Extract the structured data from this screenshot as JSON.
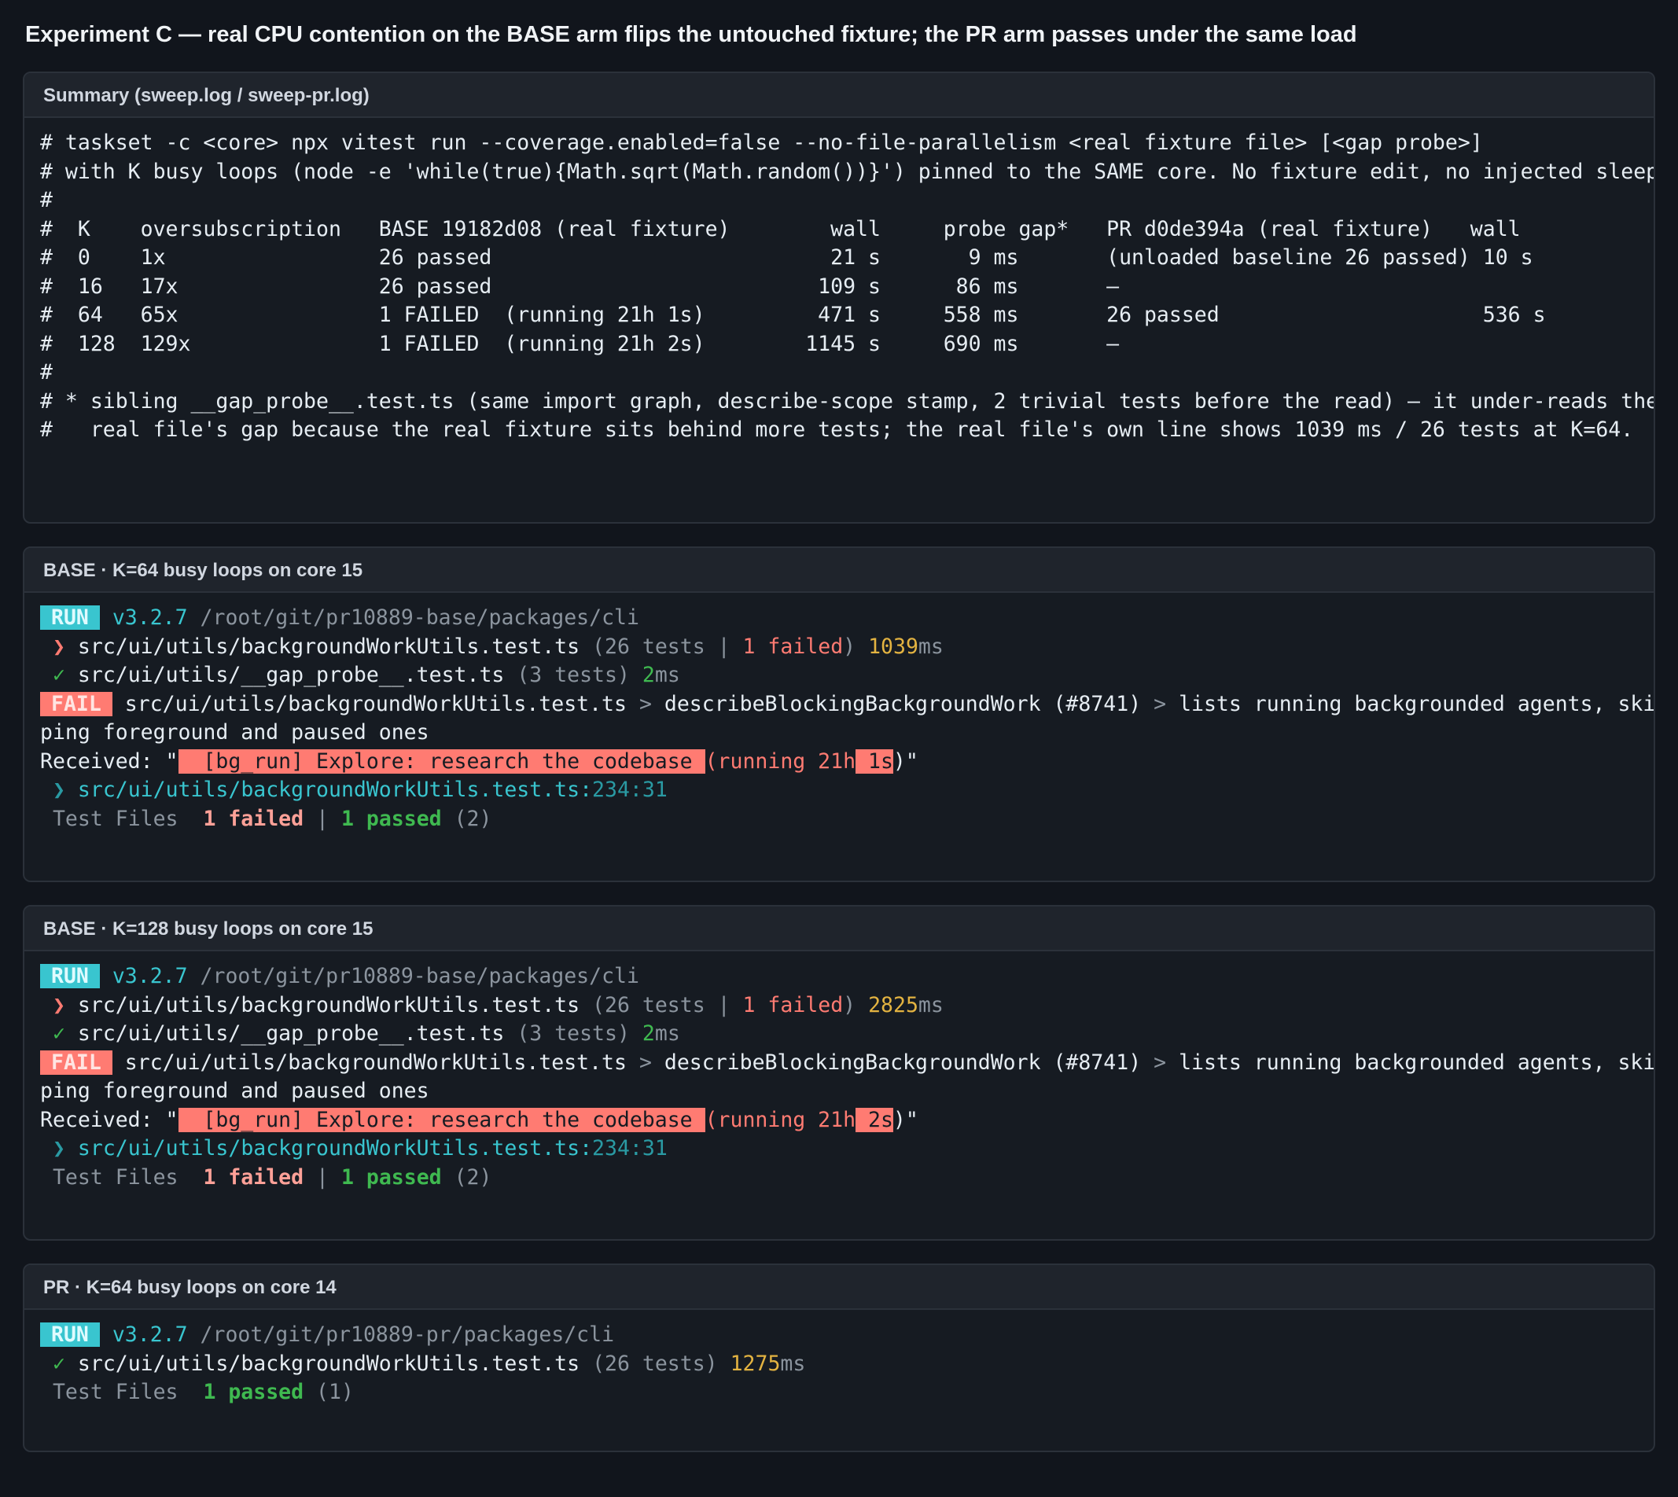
{
  "page": {
    "title": "Experiment C — real CPU contention on the BASE arm flips the untouched fixture; the PR arm passes under the same load"
  },
  "summary": {
    "header": "Summary (sweep.log / sweep-pr.log)",
    "lines": [
      "# taskset -c <core> npx vitest run --coverage.enabled=false --no-file-parallelism <real fixture file> [<gap probe>]",
      "# with K busy loops (node -e 'while(true){Math.sqrt(Math.random())}') pinned to the SAME core. No fixture edit, no injected sleep.",
      "#",
      "#  K    oversubscription   BASE 19182d08 (real fixture)        wall     probe gap*   PR d0de394a (real fixture)   wall",
      "#  0    1x                 26 passed                           21 s       9 ms       (unloaded baseline 26 passed) 10 s",
      "#  16   17x                26 passed                          109 s      86 ms       —",
      "#  64   65x                1 FAILED  (running 21h 1s)         471 s     558 ms       26 passed                     536 s",
      "#  128  129x               1 FAILED  (running 21h 2s)        1145 s     690 ms       —",
      "#",
      "# * sibling __gap_probe__.test.ts (same import graph, describe-scope stamp, 2 trivial tests before the read) — it under-reads the",
      "#   real file's gap because the real fixture sits behind more tests; the real file's own line shows 1039 ms / 26 tests at K=64."
    ]
  },
  "base64": {
    "header": "BASE · K=64 busy loops on core 15",
    "run_badge": "RUN",
    "version": "v3.2.7",
    "path": "/root/git/pr10889-base/packages/cli",
    "file1_marker": "❯",
    "file1": "src/ui/utils/backgroundWorkUtils.test.ts",
    "file1_open": "(26 tests | ",
    "file1_failed": "1 failed",
    "file1_close": ")",
    "file1_time": "1039",
    "file1_unit": "ms",
    "file2_marker": "✓",
    "file2": "src/ui/utils/__gap_probe__.test.ts",
    "file2_count": "(3 tests)",
    "file2_time": "2",
    "file2_unit": "ms",
    "fail_badge": "FAIL",
    "fail_file": "src/ui/utils/backgroundWorkUtils.test.ts",
    "sep": ">",
    "fail_describe": "describeBlockingBackgroundWork (#8741)",
    "fail_test_a": "lists running backgrounded agents, skip",
    "fail_test_b": "ping foreground and paused ones",
    "received_label": "Received: \"",
    "received_hl1": "  [bg_run] Explore: research the codebase ",
    "received_mid": "(running 21h",
    "received_hl2": " 1s",
    "received_end": ")\"",
    "loc_marker": "❯",
    "loc_file": "src/ui/utils/backgroundWorkUtils.test.ts:",
    "loc_pos": "234:31",
    "summary_label": "Test Files",
    "summary_failed": "1 failed",
    "summary_pipe": "|",
    "summary_passed": "1 passed",
    "summary_total": "(2)"
  },
  "base128": {
    "header": "BASE · K=128 busy loops on core 15",
    "run_badge": "RUN",
    "version": "v3.2.7",
    "path": "/root/git/pr10889-base/packages/cli",
    "file1_marker": "❯",
    "file1": "src/ui/utils/backgroundWorkUtils.test.ts",
    "file1_open": "(26 tests | ",
    "file1_failed": "1 failed",
    "file1_close": ")",
    "file1_time": "2825",
    "file1_unit": "ms",
    "file2_marker": "✓",
    "file2": "src/ui/utils/__gap_probe__.test.ts",
    "file2_count": "(3 tests)",
    "file2_time": "2",
    "file2_unit": "ms",
    "fail_badge": "FAIL",
    "fail_file": "src/ui/utils/backgroundWorkUtils.test.ts",
    "sep": ">",
    "fail_describe": "describeBlockingBackgroundWork (#8741)",
    "fail_test_a": "lists running backgrounded agents, skip",
    "fail_test_b": "ping foreground and paused ones",
    "received_label": "Received: \"",
    "received_hl1": "  [bg_run] Explore: research the codebase ",
    "received_mid": "(running 21h",
    "received_hl2": " 2s",
    "received_end": ")\"",
    "loc_marker": "❯",
    "loc_file": "src/ui/utils/backgroundWorkUtils.test.ts:",
    "loc_pos": "234:31",
    "summary_label": "Test Files",
    "summary_failed": "1 failed",
    "summary_pipe": "|",
    "summary_passed": "1 passed",
    "summary_total": "(2)"
  },
  "pr64": {
    "header": "PR · K=64 busy loops on core 14",
    "run_badge": "RUN",
    "version": "v3.2.7",
    "path": "/root/git/pr10889-pr/packages/cli",
    "file1_marker": "✓",
    "file1": "src/ui/utils/backgroundWorkUtils.test.ts",
    "file1_count": "(26 tests)",
    "file1_time": "1275",
    "file1_unit": "ms",
    "summary_label": "Test Files",
    "summary_passed": "1 passed",
    "summary_total": "(1)"
  }
}
